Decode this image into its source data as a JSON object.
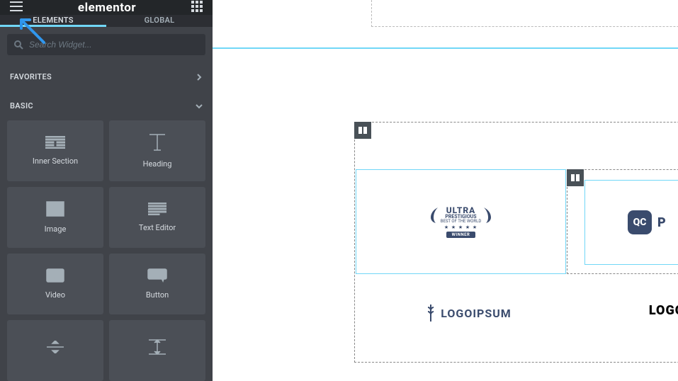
{
  "header": {
    "brand": "elementor"
  },
  "tabs": {
    "elements": "ELEMENTS",
    "global": "GLOBAL"
  },
  "search": {
    "placeholder": "Search Widget..."
  },
  "sections": {
    "favorites": "FAVORITES",
    "basic": "BASIC"
  },
  "widgets": {
    "inner_section": "Inner Section",
    "heading": "Heading",
    "image": "Image",
    "text_editor": "Text Editor",
    "video": "Video",
    "button": "Button"
  },
  "canvas": {
    "badge": {
      "title": "ULTRA",
      "subtitle": "PRESTIGIOUS",
      "tagline": "BEST OF THE WORLD",
      "stars": "★ ★ ★ ★ ★",
      "winner": "WINNER"
    },
    "qc": "QC",
    "qc_side": "P",
    "logoipsum": "LOGOIPSUM",
    "logo_right": "LOGO"
  }
}
